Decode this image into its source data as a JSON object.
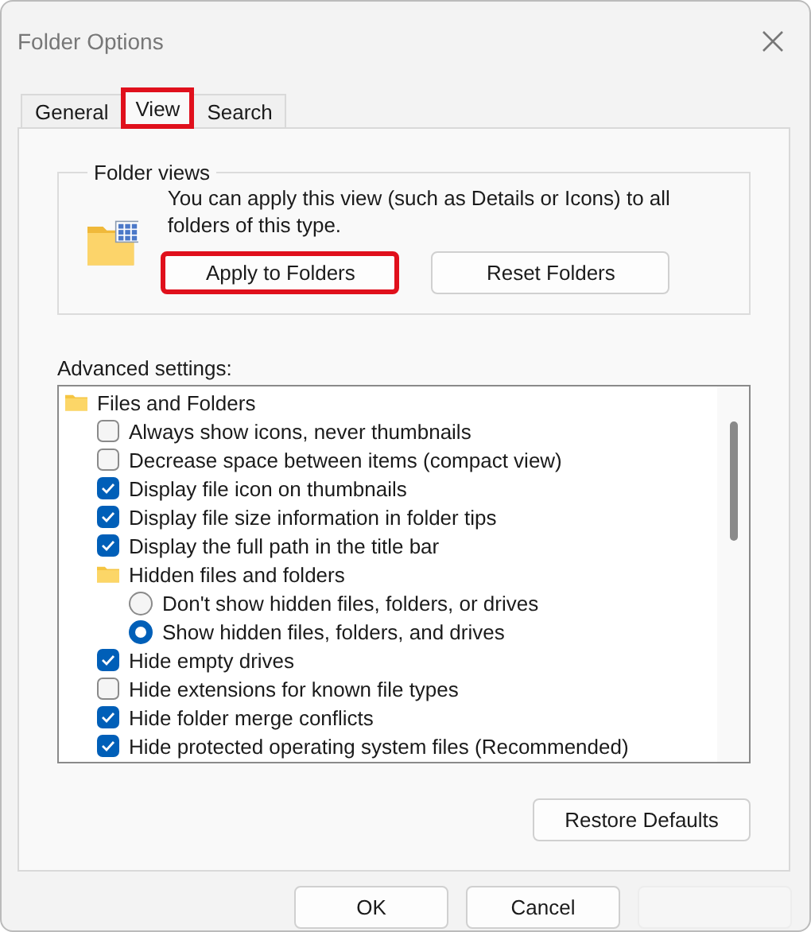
{
  "window": {
    "title": "Folder Options"
  },
  "tabs": [
    {
      "label": "General",
      "selected": false,
      "highlighted": false
    },
    {
      "label": "View",
      "selected": true,
      "highlighted": true
    },
    {
      "label": "Search",
      "selected": false,
      "highlighted": false
    }
  ],
  "folder_views": {
    "legend": "Folder views",
    "description": "You can apply this view (such as Details or Icons) to all folders of this type.",
    "buttons": [
      {
        "label": "Apply to Folders",
        "highlighted": true
      },
      {
        "label": "Reset Folders",
        "highlighted": false
      }
    ]
  },
  "advanced_settings": {
    "label": "Advanced settings:",
    "items": [
      {
        "kind": "group",
        "label": "Files and Folders",
        "children": [
          {
            "kind": "checkbox",
            "label": "Always show icons, never thumbnails",
            "checked": false
          },
          {
            "kind": "checkbox",
            "label": "Decrease space between items (compact view)",
            "checked": false
          },
          {
            "kind": "checkbox",
            "label": "Display file icon on thumbnails",
            "checked": true
          },
          {
            "kind": "checkbox",
            "label": "Display file size information in folder tips",
            "checked": true
          },
          {
            "kind": "checkbox",
            "label": "Display the full path in the title bar",
            "checked": true
          },
          {
            "kind": "group",
            "label": "Hidden files and folders",
            "children": [
              {
                "kind": "radio",
                "label": "Don't show hidden files, folders, or drives",
                "selected": false
              },
              {
                "kind": "radio",
                "label": "Show hidden files, folders, and drives",
                "selected": true
              }
            ]
          },
          {
            "kind": "checkbox",
            "label": "Hide empty drives",
            "checked": true
          },
          {
            "kind": "checkbox",
            "label": "Hide extensions for known file types",
            "checked": false
          },
          {
            "kind": "checkbox",
            "label": "Hide folder merge conflicts",
            "checked": true
          },
          {
            "kind": "checkbox",
            "label": "Hide protected operating system files (Recommended)",
            "checked": true
          }
        ]
      }
    ],
    "restore_button": "Restore Defaults"
  },
  "footer": {
    "buttons": [
      {
        "label": "OK",
        "disabled": false
      },
      {
        "label": "Cancel",
        "disabled": false
      },
      {
        "disabled": true
      }
    ]
  }
}
